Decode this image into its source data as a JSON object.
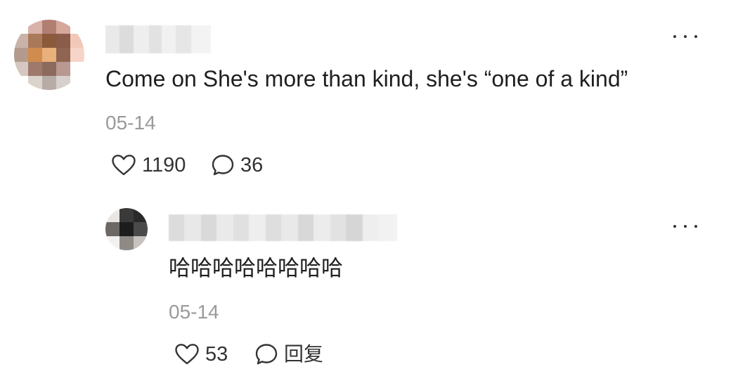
{
  "comment": {
    "text": "Come on She's more than kind, she's “one of a kind”",
    "date": "05-14",
    "likes": "1190",
    "reply_count": "36",
    "more_icon": "more-horizontal-icon",
    "like_icon": "heart-outline-icon",
    "comment_icon": "speech-bubble-icon"
  },
  "reply": {
    "text": "哈哈哈哈哈哈哈哈",
    "date": "05-14",
    "likes": "53",
    "reply_label": "回复",
    "more_icon": "more-horizontal-icon",
    "like_icon": "heart-outline-icon",
    "comment_icon": "speech-bubble-icon"
  },
  "colors": {
    "text": "#1f1f1f",
    "muted": "#9a9a9a",
    "icon": "#333333",
    "background": "#ffffff"
  }
}
